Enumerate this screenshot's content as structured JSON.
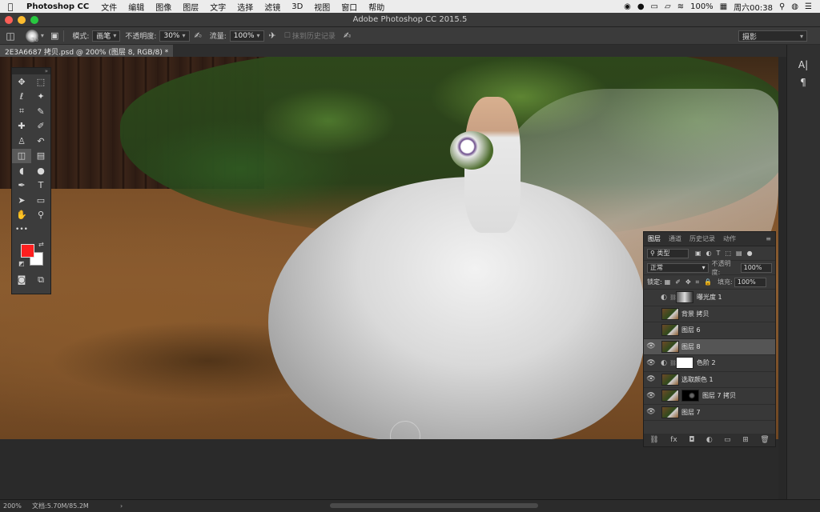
{
  "menubar": {
    "apple": "",
    "app": "Photoshop CC",
    "items": [
      "文件",
      "编辑",
      "图像",
      "图层",
      "文字",
      "选择",
      "滤镜",
      "3D",
      "视图",
      "窗口",
      "帮助"
    ],
    "battery": "100%",
    "clock": "周六00:38"
  },
  "window": {
    "title": "Adobe Photoshop CC 2015.5"
  },
  "options_bar": {
    "brush_size": "70",
    "mode_label": "模式:",
    "mode_value": "画笔",
    "opacity_label": "不透明度:",
    "opacity_value": "30%",
    "flow_label": "流量:",
    "flow_value": "100%",
    "erase_history_label": "抹到历史记录",
    "workspace_value": "摄影"
  },
  "document": {
    "tab_label": "2E3A6687 拷贝.psd @ 200% (图层 8, RGB/8) *"
  },
  "colors": {
    "foreground": "#ff1f1f",
    "background": "#ffffff"
  },
  "toolbox": {
    "tools": [
      [
        "move-tool-icon",
        "✥"
      ],
      [
        "marquee-tool-icon",
        "⬚"
      ],
      [
        "lasso-tool-icon",
        "ℓ"
      ],
      [
        "magic-wand-tool-icon",
        "✦"
      ],
      [
        "crop-tool-icon",
        "⌗"
      ],
      [
        "eyedropper-tool-icon",
        "✎"
      ],
      [
        "healing-brush-tool-icon",
        "✚"
      ],
      [
        "brush-tool-icon",
        "✐"
      ],
      [
        "clone-stamp-tool-icon",
        "♙"
      ],
      [
        "history-brush-tool-icon",
        "↶"
      ],
      [
        "eraser-tool-icon",
        "◫"
      ],
      [
        "gradient-tool-icon",
        "▤"
      ],
      [
        "blur-tool-icon",
        "◖"
      ],
      [
        "dodge-tool-icon",
        "●"
      ],
      [
        "pen-tool-icon",
        "✒"
      ],
      [
        "type-tool-icon",
        "T"
      ],
      [
        "path-selection-tool-icon",
        "➤"
      ],
      [
        "rectangle-tool-icon",
        "▭"
      ],
      [
        "hand-tool-icon",
        "✋"
      ],
      [
        "zoom-tool-icon",
        "⚲"
      ]
    ]
  },
  "layers_panel": {
    "tabs": [
      "图层",
      "通道",
      "历史记录",
      "动作"
    ],
    "filter_kind": "类型",
    "blend_mode": "正常",
    "opacity_label": "不透明度:",
    "opacity_value": "100%",
    "lock_label": "锁定:",
    "fill_label": "填充:",
    "fill_value": "100%",
    "layers": [
      {
        "name": "曝光度 1",
        "visible": false,
        "selected": false,
        "type": "adjustment",
        "mask": "gray"
      },
      {
        "name": "背景 拷贝",
        "visible": false,
        "selected": false,
        "type": "pixel"
      },
      {
        "name": "图层 6",
        "visible": false,
        "selected": false,
        "type": "pixel"
      },
      {
        "name": "图层 8",
        "visible": true,
        "selected": true,
        "type": "pixel"
      },
      {
        "name": "色阶 2",
        "visible": true,
        "selected": false,
        "type": "adjustment",
        "mask": "white"
      },
      {
        "name": "选取颜色 1",
        "visible": true,
        "selected": false,
        "type": "pixel"
      },
      {
        "name": "图层 7 拷贝",
        "visible": true,
        "selected": false,
        "type": "pixel-masked",
        "mask": "black"
      },
      {
        "name": "图层 7",
        "visible": true,
        "selected": false,
        "type": "pixel"
      }
    ]
  },
  "status_bar": {
    "zoom": "200%",
    "doc_info": "文档:5.70M/85.2M",
    "arrow": "›"
  }
}
